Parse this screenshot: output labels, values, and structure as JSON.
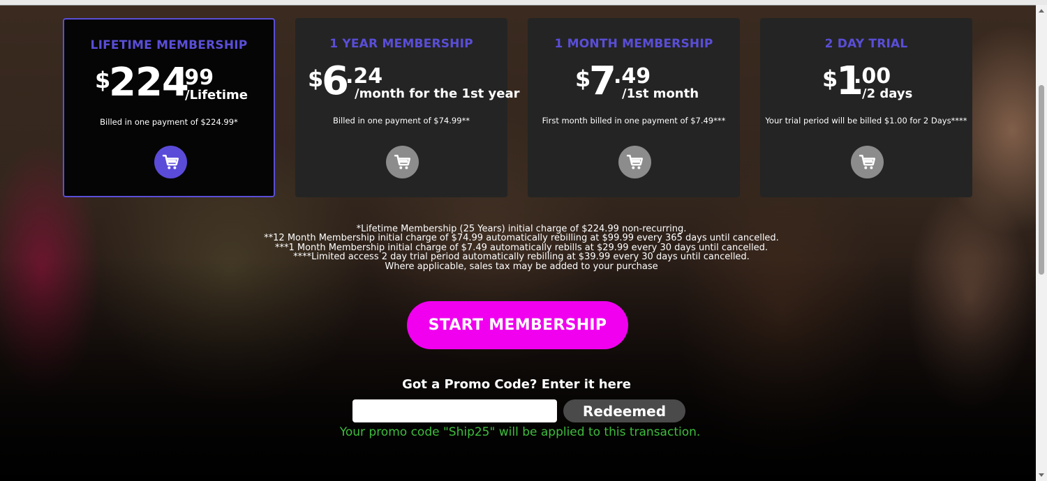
{
  "cards": [
    {
      "title": "LIFETIME MEMBERSHIP",
      "currency": "$",
      "price_int": "224",
      "price_dec": ".99",
      "period": "/Lifetime",
      "billed": "Billed in one payment of $224.99*",
      "selected": true
    },
    {
      "title": "1 YEAR MEMBERSHIP",
      "currency": "$",
      "price_int": "6",
      "price_dec": ".24",
      "period": "/month for the 1st year",
      "billed": "Billed in one payment of $74.99**",
      "selected": false
    },
    {
      "title": "1 MONTH MEMBERSHIP",
      "currency": "$",
      "price_int": "7",
      "price_dec": ".49",
      "period": "/1st month",
      "billed": "First month billed in one payment of $7.49***",
      "selected": false
    },
    {
      "title": "2 DAY TRIAL",
      "currency": "$",
      "price_int": "1",
      "price_dec": ".00",
      "period": "/2 days",
      "billed": "Your trial period will be billed $1.00 for 2 Days****",
      "selected": false
    }
  ],
  "disclaimer": [
    "*Lifetime Membership (25 Years) initial charge of $224.99 non-recurring.",
    "**12 Month Membership initial charge of $74.99 automatically rebilling at $99.99 every 365 days until cancelled.",
    "***1 Month Membership initial charge of $7.49 automatically rebills at $29.99 every 30 days until cancelled.",
    "****Limited access 2 day trial period automatically rebilling at $39.99 every 30 days until cancelled.",
    "Where applicable, sales tax may be added to your purchase"
  ],
  "cta_label": "START MEMBERSHIP",
  "promo": {
    "label": "Got a Promo Code? Enter it here",
    "value": "",
    "button_label": "Redeemed",
    "message": "Your promo code \"Ship25\" will be applied to this transaction."
  },
  "colors": {
    "accent": "#5a4ed8",
    "cta": "#f100f0",
    "success": "#3dbd3d",
    "card_bg": "#242424"
  },
  "icons": {
    "cart": "cart-icon"
  }
}
